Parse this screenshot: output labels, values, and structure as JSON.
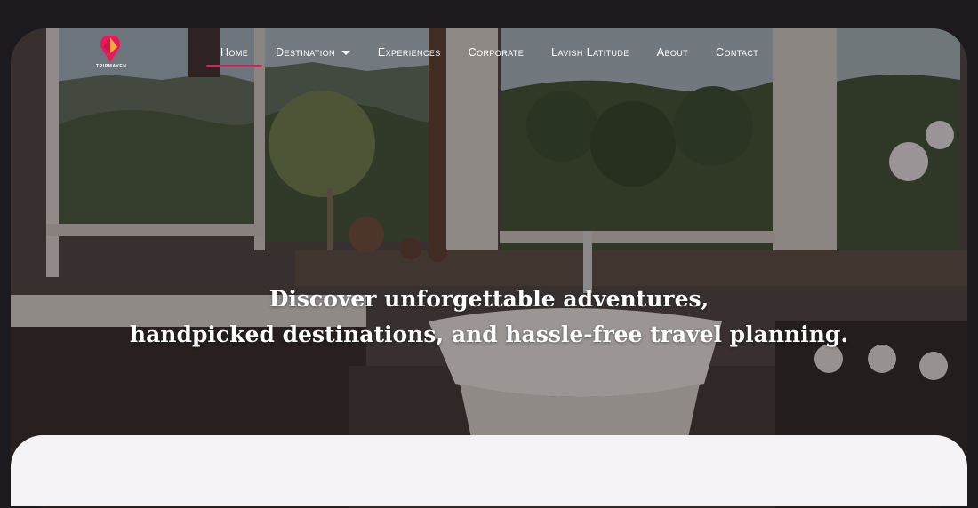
{
  "brand": {
    "name": "TRIPMAVEN",
    "accent": "#e6195a"
  },
  "nav": {
    "items": [
      {
        "label": "Home",
        "active": true
      },
      {
        "label": "Destination",
        "has_dropdown": true
      },
      {
        "label": "Experiences"
      },
      {
        "label": "Corporate"
      },
      {
        "label": "Lavish Latitude"
      },
      {
        "label": "About"
      },
      {
        "label": "Contact"
      }
    ]
  },
  "hero": {
    "line1": "Discover unforgettable adventures,",
    "line2": "handpicked destinations, and hassle-free travel planning."
  }
}
